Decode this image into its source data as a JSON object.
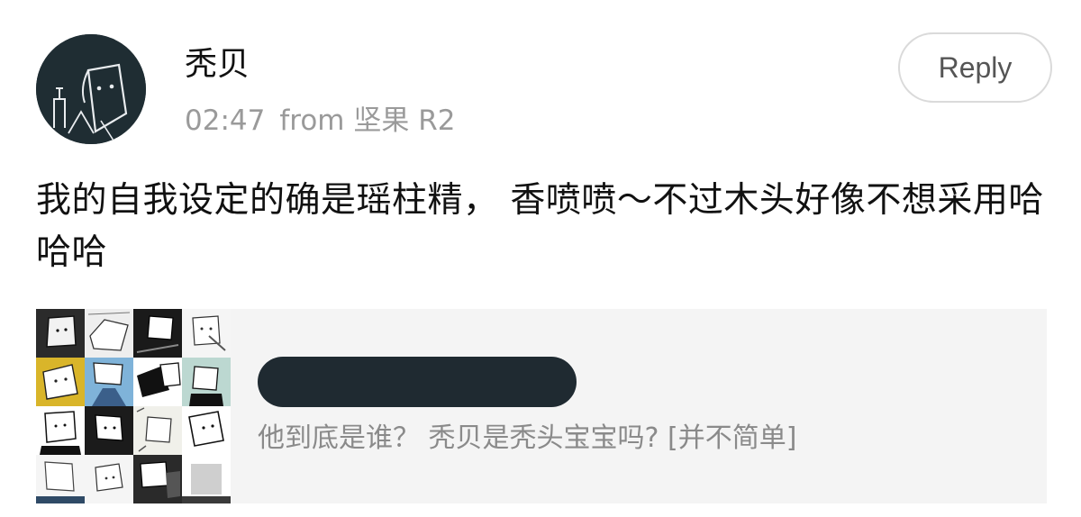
{
  "post": {
    "username": "秃贝",
    "time": "02:47",
    "source": "from 坚果 R2",
    "reply_label": "Reply",
    "text": "我的自我设定的确是瑶柱精， 香喷喷～不过木头好像不想采用哈哈哈"
  },
  "shared_card": {
    "title_redacted": true,
    "subtitle": "他到底是谁？ 秃贝是秃头宝宝吗? [并不简单]"
  },
  "colors": {
    "avatar_bg": "#1f2d33",
    "card_bg": "#f4f4f4",
    "redaction": "#1f2a31",
    "meta_text": "#9a9a9a"
  },
  "icons": {
    "avatar": "cartoon-character-avatar",
    "thumbnail": "sticker-collage-thumbnail"
  }
}
